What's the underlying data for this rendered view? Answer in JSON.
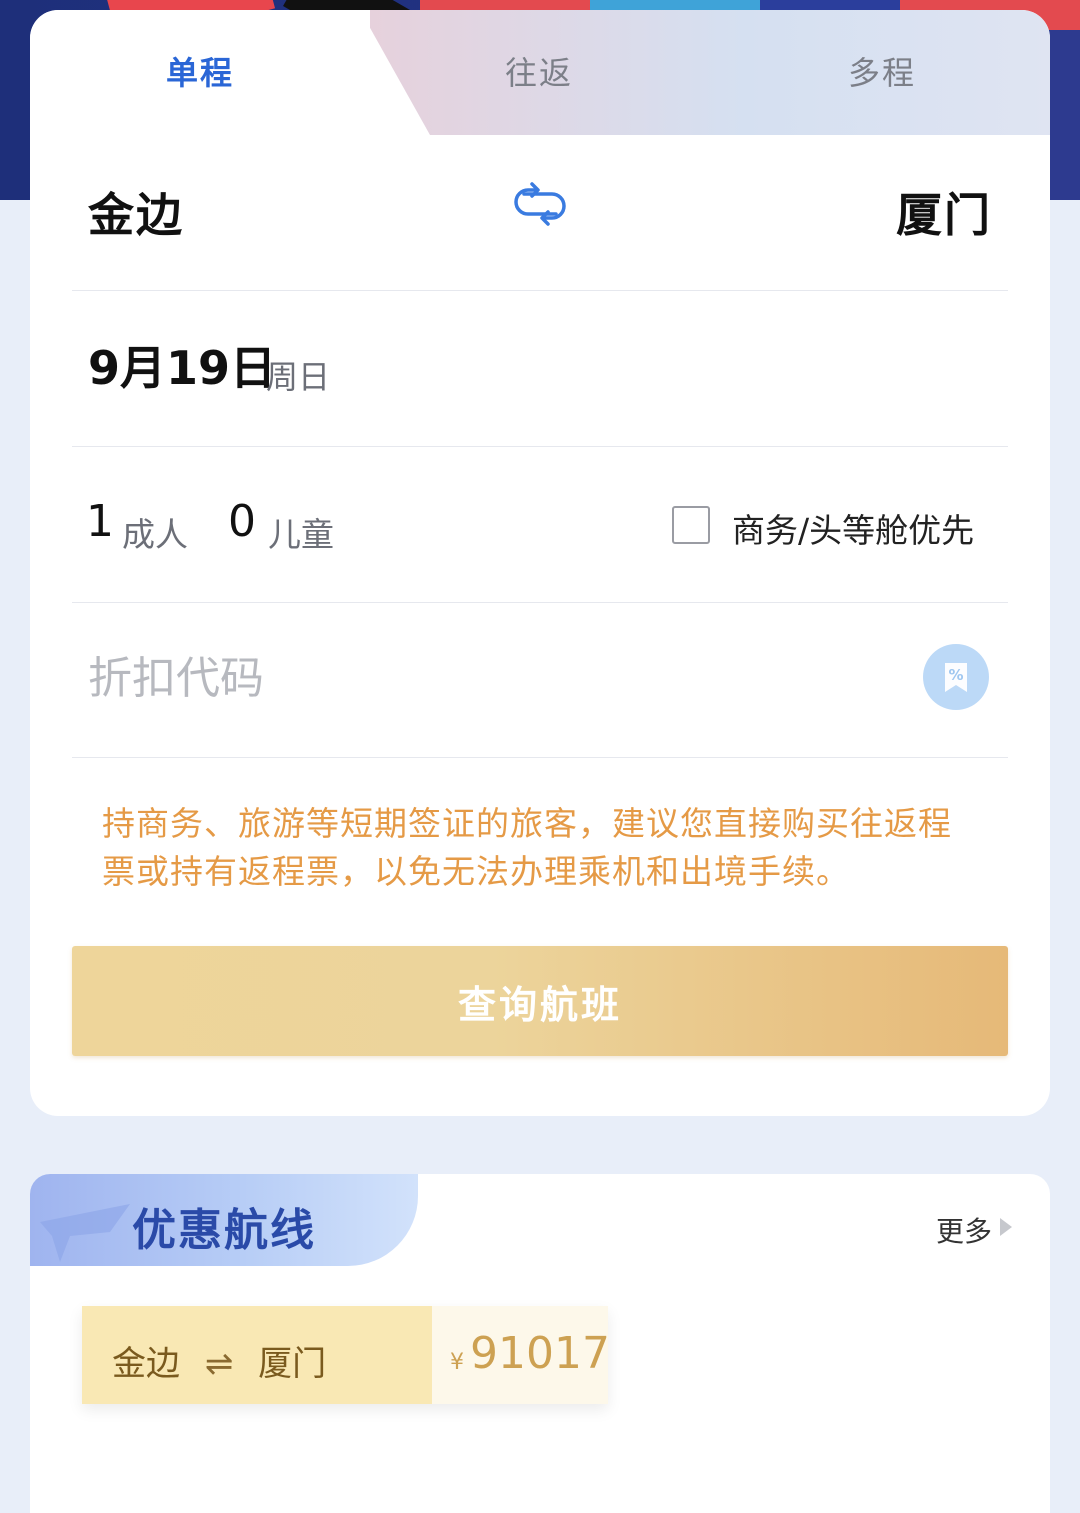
{
  "tabs": [
    {
      "label": "单程",
      "active": true
    },
    {
      "label": "往返",
      "active": false
    },
    {
      "label": "多程",
      "active": false
    }
  ],
  "route": {
    "from_city": "金边",
    "to_city": "厦门",
    "swap_icon": "swap-icon"
  },
  "date": {
    "main": "9月19日",
    "weekday": "周日"
  },
  "passengers": {
    "adult_count": "1",
    "adult_label": "成人",
    "child_count": "0",
    "child_label": "儿童",
    "business_checkbox_checked": false,
    "business_label": "商务/头等舱优先"
  },
  "promo": {
    "placeholder": "折扣代码",
    "value": "",
    "icon": "discount-icon"
  },
  "notice": "持商务、旅游等短期签证的旅客，建议您直接购买往返程票或持有返程票，以免无法办理乘机和出境手续。",
  "search_button": "查询航班",
  "deals": {
    "title": "优惠航线",
    "more": "更多",
    "items": [
      {
        "from": "金边",
        "arrow": "⇌",
        "to": "厦门",
        "currency": "¥",
        "price": "91017"
      }
    ]
  },
  "colors": {
    "accent_blue": "#2a66d6",
    "notice_orange": "#e59a46",
    "button_gold": "#e6b978",
    "price_gold": "#cda152"
  }
}
